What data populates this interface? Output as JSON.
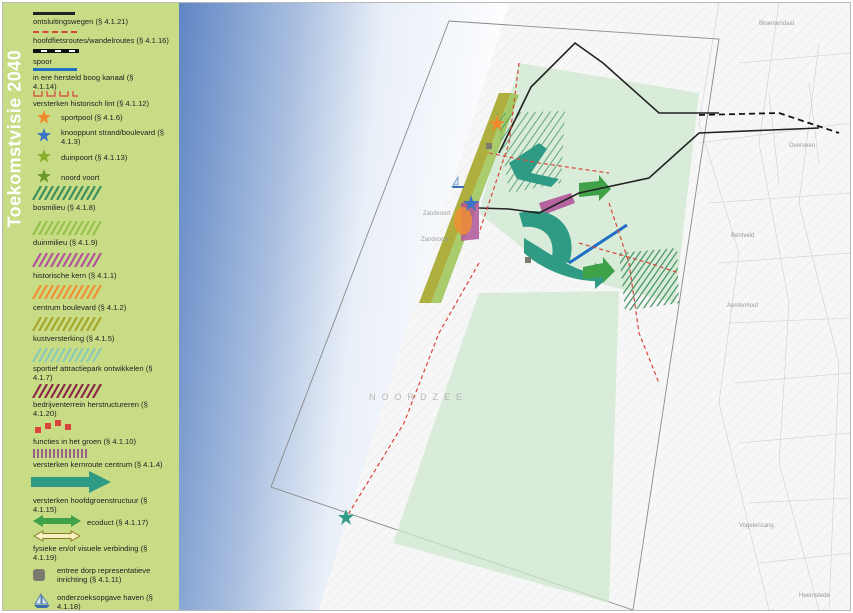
{
  "title": "Toekomstvisie 2040",
  "legend": [
    {
      "id": "ontsluitingswegen",
      "label": "ontsluitingswegen (§ 4.1.21)",
      "symbol": "road-line-icon",
      "color": "#222222"
    },
    {
      "id": "hoofdfietsroutes",
      "label": "hoofdfietsroutes/wandelroutes (§ 4.1.16)",
      "symbol": "dashed-route-icon",
      "color": "#d9453b"
    },
    {
      "id": "spoor",
      "label": "spoor",
      "symbol": "rail-line-icon",
      "color": "#111111"
    },
    {
      "id": "boog-kanaal",
      "label": "in ere hersteld boog kanaal (§ 4.1.14)",
      "symbol": "canal-line-icon",
      "color": "#1f6fc4"
    },
    {
      "id": "historisch-lint",
      "label": "versterken historisch lint (§ 4.1.12)",
      "symbol": "lint-bracket-icon",
      "color": "#d9453b"
    },
    {
      "id": "sportpool",
      "label": "sportpool (§ 4.1.6)",
      "symbol": "star-icon",
      "color": "#f08a2c"
    },
    {
      "id": "knooppunt",
      "label": "knooppunt strand/boulevard (§ 4.1.3)",
      "symbol": "star-icon",
      "color": "#3b74c4"
    },
    {
      "id": "duinpoort",
      "label": "duinpoort (§ 4.1.13)",
      "symbol": "star-icon",
      "color": "#8cae2e"
    },
    {
      "id": "noord-voort",
      "label": "noord voort",
      "symbol": "star-icon",
      "color": "#6b9a2a"
    },
    {
      "id": "bosmilieu",
      "label": "bosmilieu (§ 4.1.8)",
      "symbol": "hatch-band-icon",
      "color": "#3f8f5c"
    },
    {
      "id": "duinmilieu",
      "label": "duinmilieu (§ 4.1.9)",
      "symbol": "hatch-band-icon",
      "color": "#95c14a"
    },
    {
      "id": "historische-kern",
      "label": "historische kern (§ 4.1.1)",
      "symbol": "hatch-band-icon",
      "color": "#b0559a"
    },
    {
      "id": "centrum-boulevard",
      "label": "centrum boulevard (§ 4.1.2)",
      "symbol": "hatch-band-icon",
      "color": "#ef8e33"
    },
    {
      "id": "kustversterking",
      "label": "kustversterking (§ 4.1.5)",
      "symbol": "hatch-band-icon",
      "color": "#a6a62a"
    },
    {
      "id": "sportief-park",
      "label": "sportief attractiepark ontwikkelen (§ 4.1.7)",
      "symbol": "hatch-band-icon",
      "color": "#8cc9b6"
    },
    {
      "id": "bedrijventerrein",
      "label": "bedrijventerrein herstructureren (§ 4.1.20)",
      "symbol": "hatch-band-icon",
      "color": "#8b2a47"
    },
    {
      "id": "functies-groen",
      "label": "functies in het groen (§ 4.1.10)",
      "symbol": "red-squares-icon",
      "color": "#d9453b"
    },
    {
      "id": "kernroute",
      "label": "versterken kernroute centrum (§ 4.1.4)",
      "symbol": "purple-comb-icon",
      "color": "#8a3d86"
    },
    {
      "id": "hoofdgroenstructuur",
      "label": "versterken hoofdgroenstructuur (§ 4.1.15)",
      "symbol": "big-arrow-icon",
      "color": "#2f9b84"
    },
    {
      "id": "ecoduct",
      "label": "ecoduct (§ 4.1.17)",
      "symbol": "double-arrow-icon",
      "color": "#3fa148"
    },
    {
      "id": "visuele-verbinding",
      "label": "fysieke en/of visuele verbinding (§ 4.1.19)",
      "symbol": "outline-double-arrow-icon",
      "color": "#d4c247"
    },
    {
      "id": "entree-dorp",
      "label": "entree dorp representatieve inrichting (§ 4.1.11)",
      "symbol": "grey-square-icon",
      "color": "#7a7a6e"
    },
    {
      "id": "haven",
      "label": "onderzoeksopgave haven (§ 4.1.18)",
      "symbol": "sailboat-icon",
      "color": "#3b6fb0"
    }
  ],
  "map": {
    "sea_label": "NOORDZEE",
    "places": [
      "Zandvoort",
      "Zandvoort",
      "Bloemendaal",
      "Overveen",
      "Heemstede",
      "Bentveld",
      "Aerdenhout",
      "Vogelenzang"
    ],
    "colors": {
      "sea": "#5f86c4",
      "dune_green": "#cfe8cf",
      "forest": "#3f8f5c",
      "dune": "#95c14a",
      "center": "#b0559a",
      "boulevard": "#ef8e33",
      "coast": "#a6a62a",
      "corridor": "#2f9b84",
      "route": "#d9453b",
      "canal": "#1f6fc4",
      "road": "#222222"
    }
  }
}
